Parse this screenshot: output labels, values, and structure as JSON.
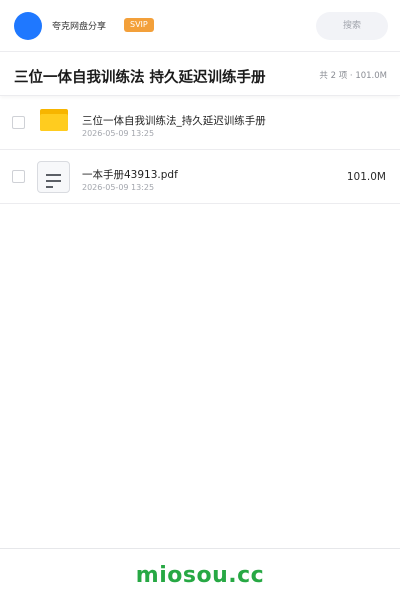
{
  "header": {
    "app_name": "夸克网盘分享",
    "badge": "SVIP",
    "search_placeholder": "搜索",
    "brand_color": "#1f78ff",
    "badge_color": "#f3a03a"
  },
  "share": {
    "title": "三位一体自我训练法 持久延迟训练手册",
    "summary": "共 2 项 · 101.0M"
  },
  "files": [
    {
      "name": "三位一体自我训练法_持久延迟训练手册",
      "date": "2026-05-09 13:25",
      "size": "",
      "icon": "folder-icon"
    },
    {
      "name": "一本手册43913.pdf",
      "date": "2026-05-09 13:25",
      "size": "101.0M",
      "icon": "document-icon"
    }
  ],
  "footer": {
    "brand": "miosou.cc",
    "brand_color": "#27a844"
  }
}
